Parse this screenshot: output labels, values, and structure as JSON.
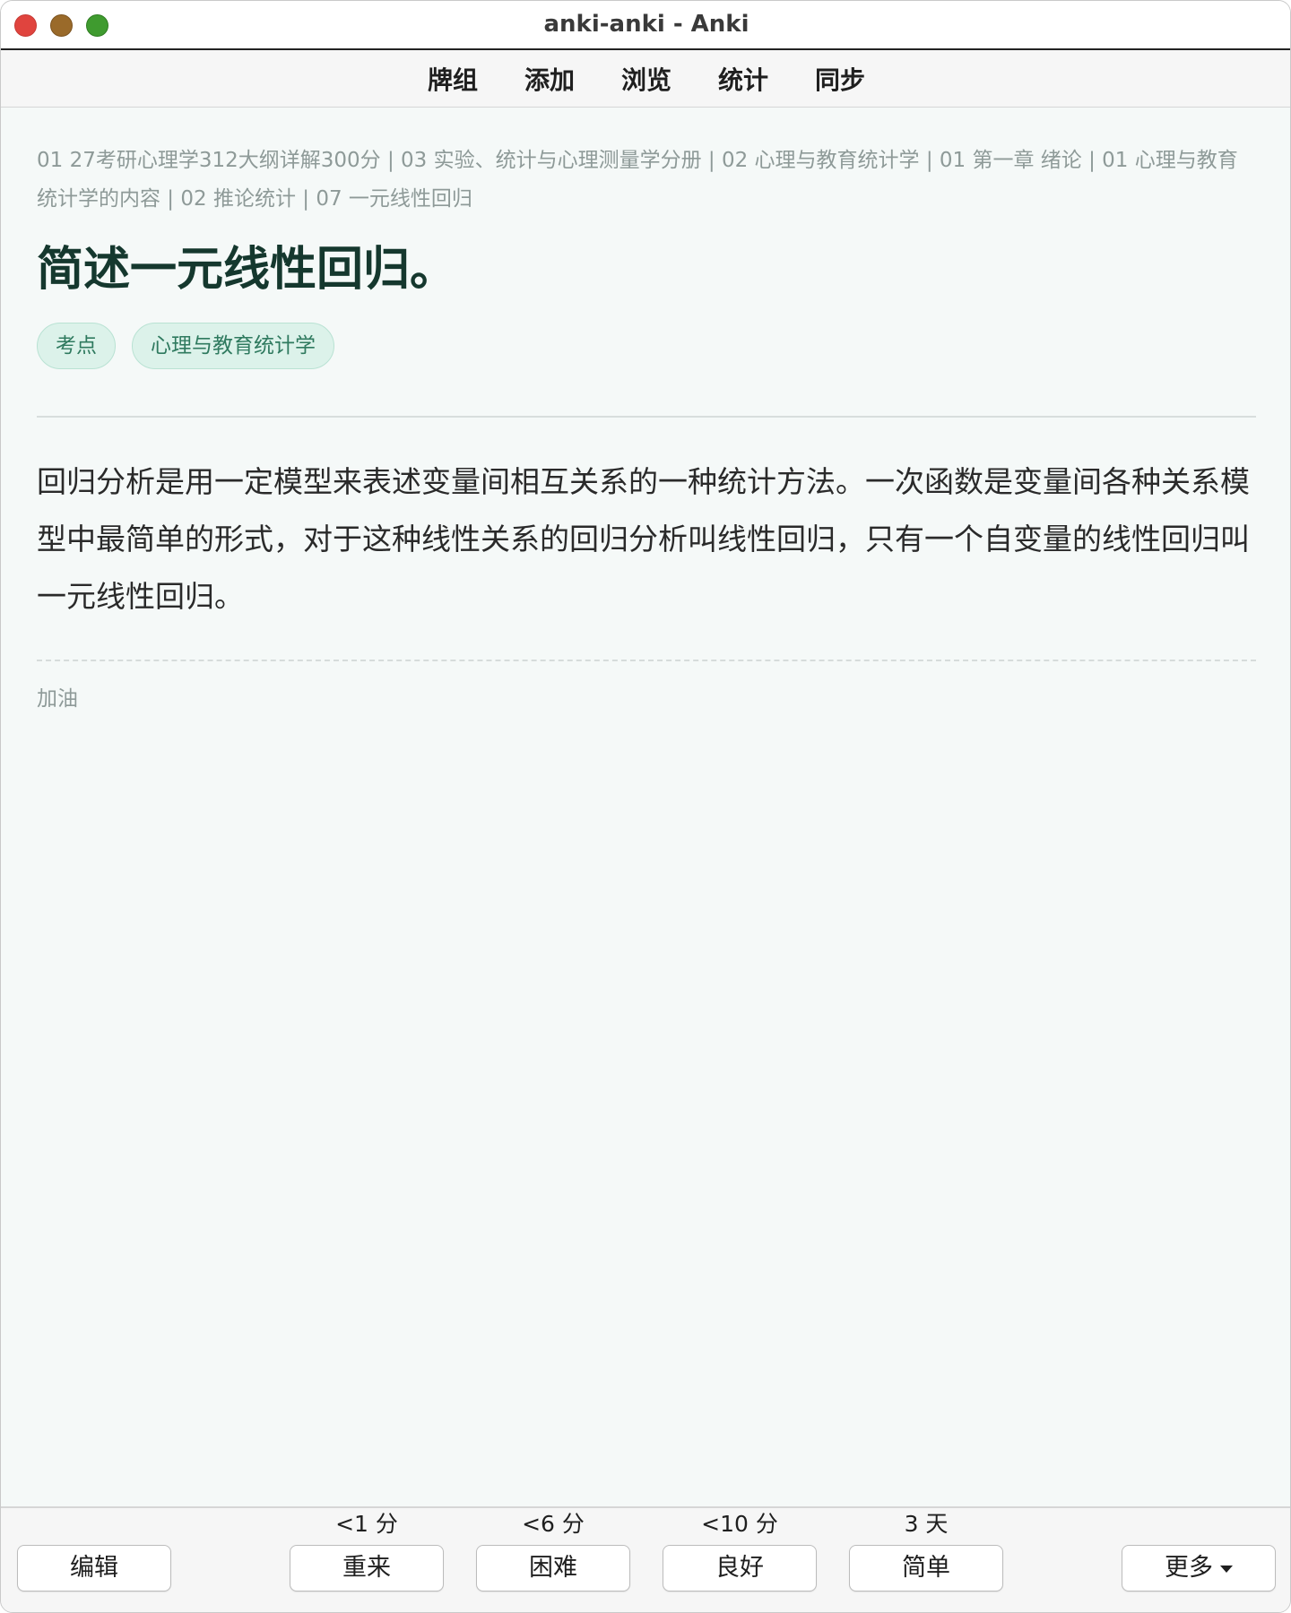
{
  "window": {
    "title": "anki-anki - Anki"
  },
  "toolbar": {
    "items": [
      {
        "label": "牌组"
      },
      {
        "label": "添加"
      },
      {
        "label": "浏览"
      },
      {
        "label": "统计"
      },
      {
        "label": "同步"
      }
    ]
  },
  "card": {
    "breadcrumb": "01 27考研心理学312大纲详解300分 | 03 实验、统计与心理测量学分册 | 02 心理与教育统计学 | 01 第一章 绪论 | 01 心理与教育统计学的内容 | 02 推论统计 | 07 一元线性回归",
    "question": "简述一元线性回归。",
    "tags": [
      {
        "label": "考点"
      },
      {
        "label": "心理与教育统计学"
      }
    ],
    "answer": "回归分析是用一定模型来表述变量间相互关系的一种统计方法。一次函数是变量间各种关系模型中最简单的形式，对于这种线性关系的回归分析叫线性回归，只有一个自变量的线性回归叫一元线性回归。",
    "extra": "加油"
  },
  "bottombar": {
    "edit_label": "编辑",
    "more_label": "更多",
    "answers": [
      {
        "label": "重来",
        "interval": "<1 分"
      },
      {
        "label": "困难",
        "interval": "<6 分"
      },
      {
        "label": "良好",
        "interval": "<10 分"
      },
      {
        "label": "简单",
        "interval": "3 天"
      }
    ]
  },
  "colors": {
    "window_close": "#e0443e",
    "window_minimize": "#9a6a2a",
    "window_zoom": "#3f9b2f",
    "question_text": "#15382e",
    "tag_background": "#dcf2ea",
    "tag_text": "#2f7a5f",
    "breadcrumb_text": "#8e9a98",
    "content_background": "#f5f9f8"
  }
}
